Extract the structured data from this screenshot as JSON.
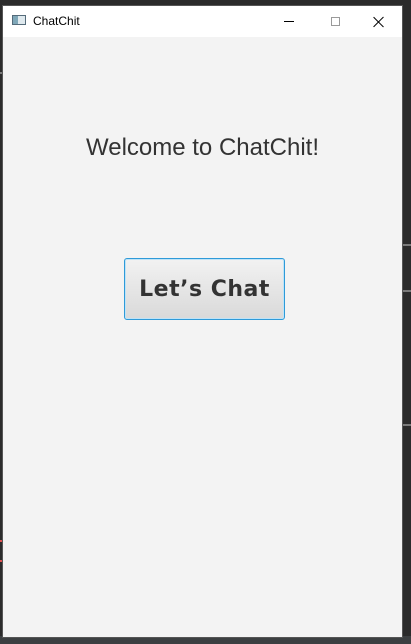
{
  "window": {
    "title": "ChatChit",
    "app_icon": "app-window-icon",
    "controls": {
      "minimize": "minimize-icon",
      "maximize": "maximize-icon",
      "close": "close-icon"
    }
  },
  "main": {
    "welcome_text": "Welcome to ChatChit!",
    "chat_button_label": "Let’s Chat",
    "accent_color": "#2e9ad8"
  }
}
